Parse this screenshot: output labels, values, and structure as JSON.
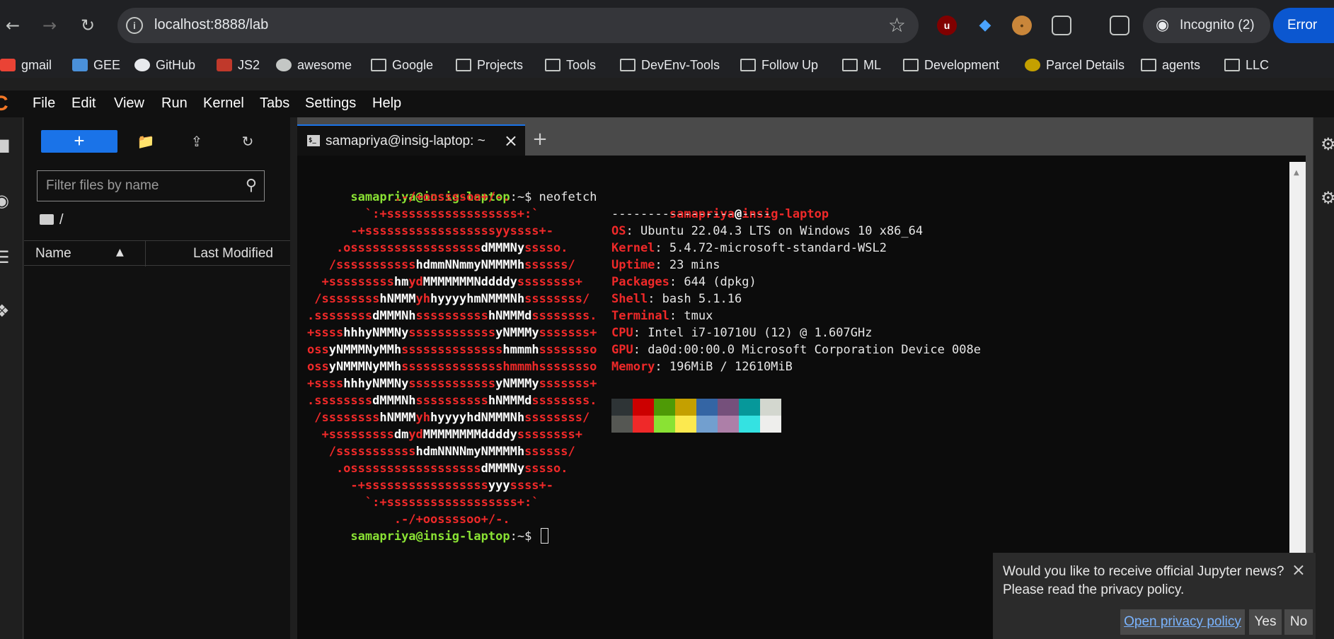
{
  "browser": {
    "url": "localhost:8888/lab",
    "incognito_label": "Incognito (2)",
    "error_label": "Error"
  },
  "bookmarks": [
    {
      "label": "gmail",
      "icon": "gmail-icon"
    },
    {
      "label": "GEE",
      "icon": "gee-icon"
    },
    {
      "label": "GitHub",
      "icon": "github-icon"
    },
    {
      "label": "JS2",
      "icon": "js2-icon"
    },
    {
      "label": "awesome",
      "icon": "globe-icon"
    },
    {
      "label": "Google",
      "icon": "folder-icon"
    },
    {
      "label": "Projects",
      "icon": "folder-icon"
    },
    {
      "label": "Tools",
      "icon": "folder-icon"
    },
    {
      "label": "DevEnv-Tools",
      "icon": "folder-icon"
    },
    {
      "label": "Follow Up",
      "icon": "folder-icon"
    },
    {
      "label": "ML",
      "icon": "folder-icon"
    },
    {
      "label": "Development",
      "icon": "folder-icon"
    },
    {
      "label": "Parcel Details",
      "icon": "parcel-icon"
    },
    {
      "label": "agents",
      "icon": "folder-icon"
    },
    {
      "label": "LLC",
      "icon": "folder-icon"
    }
  ],
  "menu": [
    "File",
    "Edit",
    "View",
    "Run",
    "Kernel",
    "Tabs",
    "Settings",
    "Help"
  ],
  "filebrowser": {
    "filter_placeholder": "Filter files by name",
    "breadcrumb": "/",
    "col_name": "Name",
    "col_modified": "Last Modified",
    "new_label": "+"
  },
  "tab": {
    "label": "samapriya@insig-laptop: ~",
    "icon_text": "$_"
  },
  "terminal": {
    "user": "samapriya@insig-laptop",
    "path_sep": ":~$ ",
    "command": "neofetch",
    "info_user": "samapriya",
    "info_at": "@",
    "info_host": "insig-laptop",
    "separator": "----------------------",
    "info": [
      {
        "key": "OS",
        "value": ": Ubuntu 22.04.3 LTS on Windows 10 x86_64"
      },
      {
        "key": "Kernel",
        "value": ": 5.4.72-microsoft-standard-WSL2"
      },
      {
        "key": "Uptime",
        "value": ": 23 mins"
      },
      {
        "key": "Packages",
        "value": ": 644 (dpkg)"
      },
      {
        "key": "Shell",
        "value": ": bash 5.1.16"
      },
      {
        "key": "Terminal",
        "value": ": tmux"
      },
      {
        "key": "CPU",
        "value": ": Intel i7-10710U (12) @ 1.607GHz"
      },
      {
        "key": "GPU",
        "value": ": da0d:00:00.0 Microsoft Corporation Device 008e"
      },
      {
        "key": "Memory",
        "value": ": 196MiB / 12610MiB"
      }
    ],
    "swatches_top": [
      "#2e3436",
      "#cc0000",
      "#4e9a06",
      "#c4a000",
      "#3465a4",
      "#75507b",
      "#06989a",
      "#d3d7cf"
    ],
    "swatches_bottom": [
      "#555753",
      "#ef2929",
      "#8ae234",
      "#fce94f",
      "#729fcf",
      "#ad7fa8",
      "#34e2e2",
      "#eeeeec"
    ],
    "logo": [
      [
        [
          "r",
          "            .-/+oossssoo+/-."
        ]
      ],
      [
        [
          "r",
          "        `:+ssssssssssssssssss+:`"
        ]
      ],
      [
        [
          "r",
          "      -+ssssssssssssssssssyyssss+-"
        ]
      ],
      [
        [
          "r",
          "    .ossssssssssssssssss"
        ],
        [
          "w",
          "dMMMNy"
        ],
        [
          "r",
          "sssso."
        ]
      ],
      [
        [
          "r",
          "   /sssssssssss"
        ],
        [
          "w",
          "hdmmNNmmyNMMMMh"
        ],
        [
          "r",
          "ssssss/"
        ]
      ],
      [
        [
          "r",
          "  +sssssssss"
        ],
        [
          "w",
          "hm"
        ],
        [
          "r",
          "yd"
        ],
        [
          "w",
          "MMMMMMMNddddy"
        ],
        [
          "r",
          "ssssssss+"
        ]
      ],
      [
        [
          "r",
          " /ssssssss"
        ],
        [
          "w",
          "hNMMM"
        ],
        [
          "r",
          "yh"
        ],
        [
          "w",
          "hyyyyhmNMMMNh"
        ],
        [
          "r",
          "ssssssss/"
        ]
      ],
      [
        [
          "r",
          ".ssssssss"
        ],
        [
          "w",
          "dMMMNh"
        ],
        [
          "r",
          "ssssssssss"
        ],
        [
          "w",
          "hNMMMd"
        ],
        [
          "r",
          "ssssssss."
        ]
      ],
      [
        [
          "r",
          "+ssss"
        ],
        [
          "w",
          "hhhyNMMNy"
        ],
        [
          "r",
          "ssssssssssss"
        ],
        [
          "w",
          "yNMMMy"
        ],
        [
          "r",
          "sssssss+"
        ]
      ],
      [
        [
          "r",
          "oss"
        ],
        [
          "w",
          "yNMMMNyMMh"
        ],
        [
          "r",
          "ssssssssssssss"
        ],
        [
          "w",
          "hmmmh"
        ],
        [
          "r",
          "ssssssso"
        ]
      ],
      [
        [
          "r",
          "oss"
        ],
        [
          "w",
          "yNMMMNyMMh"
        ],
        [
          "r",
          "sssssssssssssshmmmhssssssso"
        ]
      ],
      [
        [
          "r",
          "+ssss"
        ],
        [
          "w",
          "hhhyNMMNy"
        ],
        [
          "r",
          "ssssssssssss"
        ],
        [
          "w",
          "yNMMMy"
        ],
        [
          "r",
          "sssssss+"
        ]
      ],
      [
        [
          "r",
          ".ssssssss"
        ],
        [
          "w",
          "dMMMNh"
        ],
        [
          "r",
          "ssssssssss"
        ],
        [
          "w",
          "hNMMMd"
        ],
        [
          "r",
          "ssssssss."
        ]
      ],
      [
        [
          "r",
          " /ssssssss"
        ],
        [
          "w",
          "hNMMM"
        ],
        [
          "r",
          "yh"
        ],
        [
          "w",
          "hyyyyhdNMMMNh"
        ],
        [
          "r",
          "ssssssss/"
        ]
      ],
      [
        [
          "r",
          "  +sssssssss"
        ],
        [
          "w",
          "dm"
        ],
        [
          "r",
          "yd"
        ],
        [
          "w",
          "MMMMMMMMddddy"
        ],
        [
          "r",
          "ssssssss+"
        ]
      ],
      [
        [
          "r",
          "   /sssssssssss"
        ],
        [
          "w",
          "hdmNNNNmyNMMMMh"
        ],
        [
          "r",
          "ssssss/"
        ]
      ],
      [
        [
          "r",
          "    .ossssssssssssssssss"
        ],
        [
          "w",
          "dMMMNy"
        ],
        [
          "r",
          "sssso."
        ]
      ],
      [
        [
          "r",
          "      -+sssssssssssssssss"
        ],
        [
          "w",
          "yyy"
        ],
        [
          "r",
          "ssss+-"
        ]
      ],
      [
        [
          "r",
          "        `:+ssssssssssssssssss+:`"
        ]
      ],
      [
        [
          "r",
          "            .-/+oossssoo+/-."
        ]
      ]
    ]
  },
  "toast": {
    "line1": "Would you like to receive official Jupyter news?",
    "line2": "Please read the privacy policy.",
    "privacy_label": "Open privacy policy",
    "yes_label": "Yes",
    "no_label": "No"
  }
}
